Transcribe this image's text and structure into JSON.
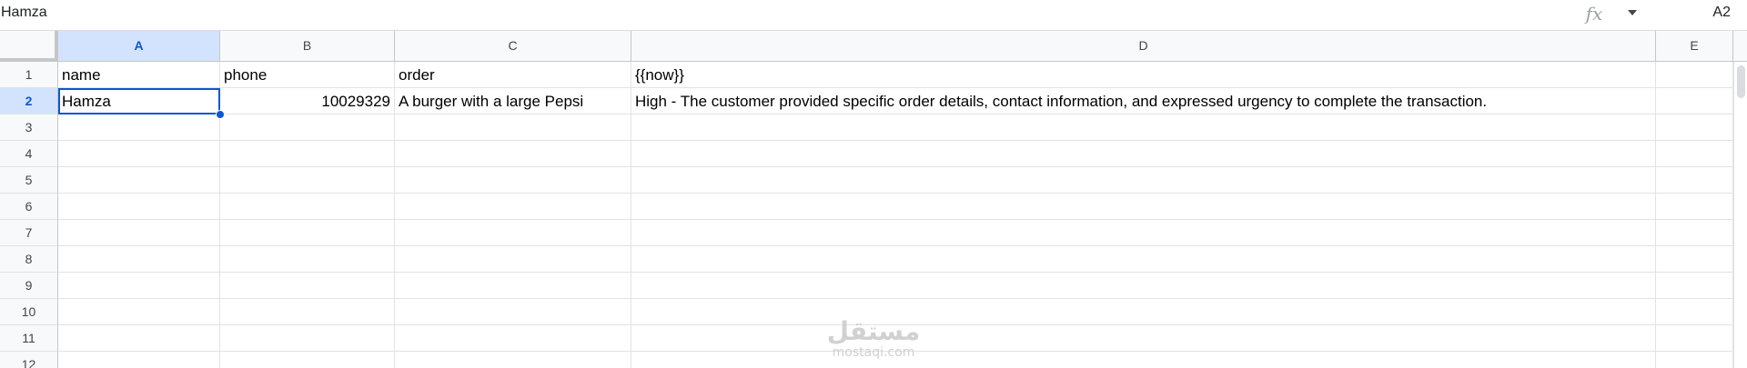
{
  "formula_bar": {
    "content": "Hamza",
    "fx_icon": "fx-icon",
    "name_box": "A2"
  },
  "columns": [
    {
      "label": "A"
    },
    {
      "label": "B"
    },
    {
      "label": "C"
    },
    {
      "label": "D"
    },
    {
      "label": "E"
    }
  ],
  "rows": [
    "1",
    "2",
    "3",
    "4",
    "5",
    "6",
    "7",
    "8",
    "9",
    "10",
    "11",
    "12"
  ],
  "cells": {
    "A1": "name",
    "B1": "phone",
    "C1": "order",
    "D1": "{{now}}",
    "A2": "Hamza",
    "B2": "10029329",
    "C2": "A burger with a large Pepsi",
    "D2": "High - The customer provided specific order details, contact information, and expressed urgency to complete the transaction."
  },
  "selection": {
    "active_cell": "A2",
    "column": "A",
    "row": "2"
  },
  "watermark": {
    "text_main": "مستقل",
    "text_sub": "mostaqi.com"
  },
  "colors": {
    "selection": "#0b57d0",
    "selected_header_bg": "#d3e3fd",
    "header_bg": "#f8f9fa",
    "gridline": "#e1e3e1"
  }
}
